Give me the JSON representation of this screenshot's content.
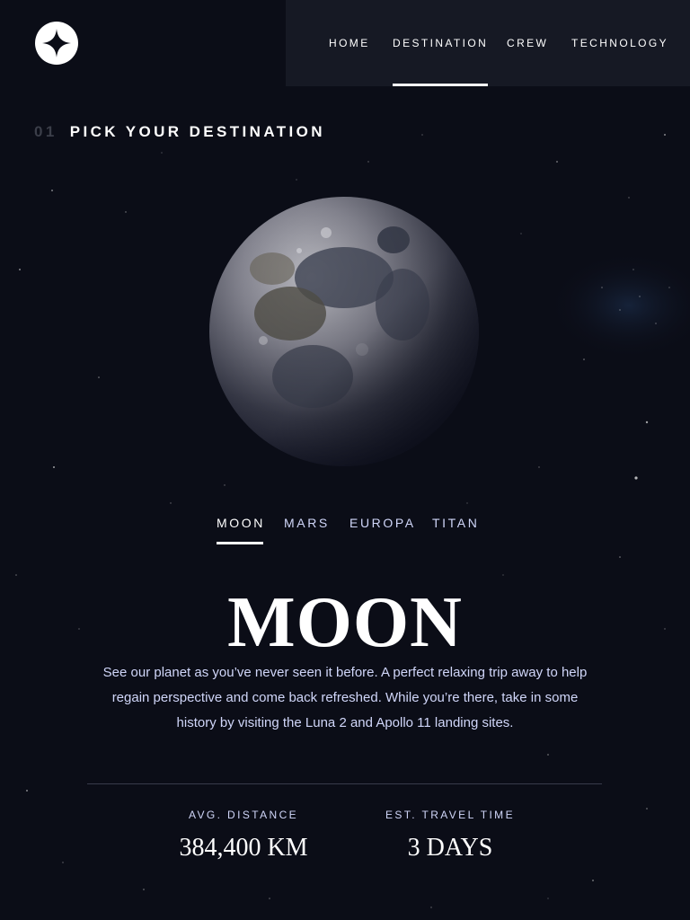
{
  "brand": {
    "logo_icon": "star-logo-icon"
  },
  "nav": {
    "items": [
      {
        "label": "HOME"
      },
      {
        "label": "DESTINATION",
        "active": true
      },
      {
        "label": "CREW"
      },
      {
        "label": "TECHNOLOGY"
      }
    ]
  },
  "page": {
    "number": "01",
    "heading": "PICK YOUR DESTINATION"
  },
  "destination": {
    "tabs": [
      {
        "label": "MOON",
        "active": true
      },
      {
        "label": "MARS"
      },
      {
        "label": "EUROPA"
      },
      {
        "label": "TITAN"
      }
    ],
    "name": "MOON",
    "description": "See our planet as you’ve never seen it before. A perfect relaxing trip away to help regain perspective and come back refreshed. While you’re there, take in some history by visiting the Luna 2 and Apollo 11 landing sites.",
    "planet_image": "moon-image",
    "stats": [
      {
        "label": "AVG. DISTANCE",
        "value": "384,400 KM"
      },
      {
        "label": "EST. TRAVEL TIME",
        "value": "3 DAYS"
      }
    ]
  },
  "colors": {
    "background": "#0b0d17",
    "nav_background": "#161924",
    "text_primary": "#ffffff",
    "text_secondary": "#d0d6f9",
    "muted": "#3b3e49",
    "divider": "#383b4b"
  }
}
